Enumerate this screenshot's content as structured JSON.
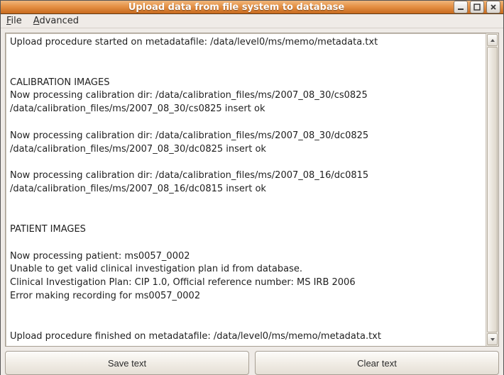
{
  "window": {
    "title": "Upload data from file system to database"
  },
  "menubar": {
    "file": {
      "label": "File",
      "accel_index": 0
    },
    "advanced": {
      "label": "Advanced",
      "accel_index": 0
    }
  },
  "log": {
    "text": "Upload procedure started on metadatafile: /data/level0/ms/memo/metadata.txt\n\n\nCALIBRATION IMAGES\nNow processing calibration dir: /data/calibration_files/ms/2007_08_30/cs0825\n/data/calibration_files/ms/2007_08_30/cs0825 insert ok\n\nNow processing calibration dir: /data/calibration_files/ms/2007_08_30/dc0825\n/data/calibration_files/ms/2007_08_30/dc0825 insert ok\n\nNow processing calibration dir: /data/calibration_files/ms/2007_08_16/dc0815\n/data/calibration_files/ms/2007_08_16/dc0815 insert ok\n\n\nPATIENT IMAGES\n\nNow processing patient: ms0057_0002\nUnable to get valid clinical investigation plan id from database.\nClinical Investigation Plan: CIP 1.0, Official reference number: MS IRB 2006\nError making recording for ms0057_0002\n\n\nUpload procedure finished on metadatafile: /data/level0/ms/memo/metadata.txt"
  },
  "buttons": {
    "save": "Save text",
    "clear": "Clear text"
  }
}
